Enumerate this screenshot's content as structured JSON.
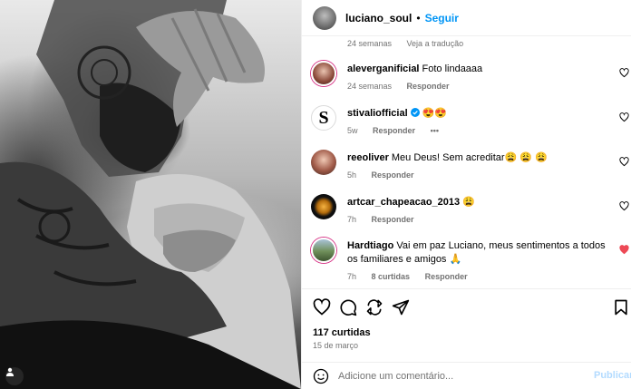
{
  "post": {
    "username": "luciano_soul",
    "separator": "•",
    "follow_label": "Seguir",
    "likes_text": "117 curtidas",
    "date_text": "15 de março",
    "add_comment_placeholder": "Adicione um comentário...",
    "publish_label": "Publicar"
  },
  "comments": [
    {
      "username": "",
      "text": "",
      "time": "24 semanas",
      "extra": "Veja a tradução",
      "reply": "",
      "liked": false,
      "partial": true
    },
    {
      "username": "aleverganificial",
      "text": "Foto lindaaaa",
      "time": "24 semanas",
      "extra": "",
      "reply": "Responder",
      "liked": false
    },
    {
      "username": "stivaliofficial",
      "text": "😍😍",
      "time": "5w",
      "extra": "",
      "reply": "Responder",
      "more": "•••",
      "verified": true,
      "liked": false
    },
    {
      "username": "reeoliver",
      "text": "Meu Deus! Sem acreditar😩 😩 😩",
      "time": "5h",
      "extra": "",
      "reply": "Responder",
      "liked": false
    },
    {
      "username": "artcar_chapeacao_2013",
      "text": "😩",
      "time": "7h",
      "extra": "",
      "reply": "Responder",
      "liked": false
    },
    {
      "username": "Hardtiago",
      "text": "Vai em paz Luciano, meus sentimentos a todos os familiares e amigos 🙏",
      "time": "7h",
      "extra": "8 curtidas",
      "reply": "Responder",
      "liked": true
    }
  ],
  "icons": {
    "like": "heart-icon",
    "comment": "comment-icon",
    "share": "share-icon",
    "send": "send-icon",
    "save": "bookmark-icon",
    "emoji": "emoji-icon",
    "verified": "verified-badge-icon"
  },
  "colors": {
    "link_blue": "#0095f6",
    "liked_red": "#ed4956",
    "muted": "#737373",
    "publish_disabled": "#b3dbff"
  }
}
